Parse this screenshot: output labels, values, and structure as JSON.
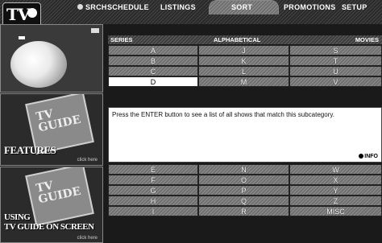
{
  "menu": {
    "logo": "TV",
    "search": "SRCH",
    "items": [
      "SCHEDULE",
      "LISTINGS",
      "SORT",
      "PROMOTIONS",
      "SETUP"
    ]
  },
  "panel": {
    "promo1_title": "FEATURES",
    "promo1_click": "click here",
    "promo2_line1": "USING",
    "promo2_line2": "TV GUIDE ON SCREEN",
    "promo2_click": "click here",
    "logo_text": "TV GUIDE"
  },
  "grid": {
    "header_left": "SERIES",
    "header_center": "ALPHABETICAL",
    "header_right": "MOVIES",
    "top_rows": [
      [
        "A",
        "J",
        "S"
      ],
      [
        "B",
        "K",
        "T"
      ],
      [
        "C",
        "L",
        "U"
      ],
      [
        "D",
        "M",
        "V"
      ]
    ],
    "bottom_rows": [
      [
        "E",
        "N",
        "W"
      ],
      [
        "F",
        "O",
        "X"
      ],
      [
        "G",
        "P",
        "Y"
      ],
      [
        "H",
        "Q",
        "Z"
      ],
      [
        "I",
        "R",
        "MISC"
      ]
    ],
    "selected": "D"
  },
  "description": {
    "text": "Press the ENTER button to see a list of all shows that match this subcategory.",
    "info_label": "INFO"
  }
}
